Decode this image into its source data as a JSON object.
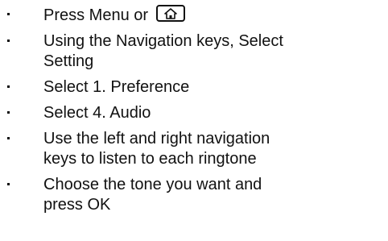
{
  "steps": [
    {
      "text": "Press Menu or",
      "icon": "home-icon"
    },
    {
      "text": "Using the Navigation keys, Select Setting"
    },
    {
      "text": "Select 1. Preference"
    },
    {
      "text": "Select 4. Audio"
    },
    {
      "text": "Use the left and right navigation keys to listen to each ringtone"
    },
    {
      "text": "Choose the tone you want and press OK"
    }
  ]
}
